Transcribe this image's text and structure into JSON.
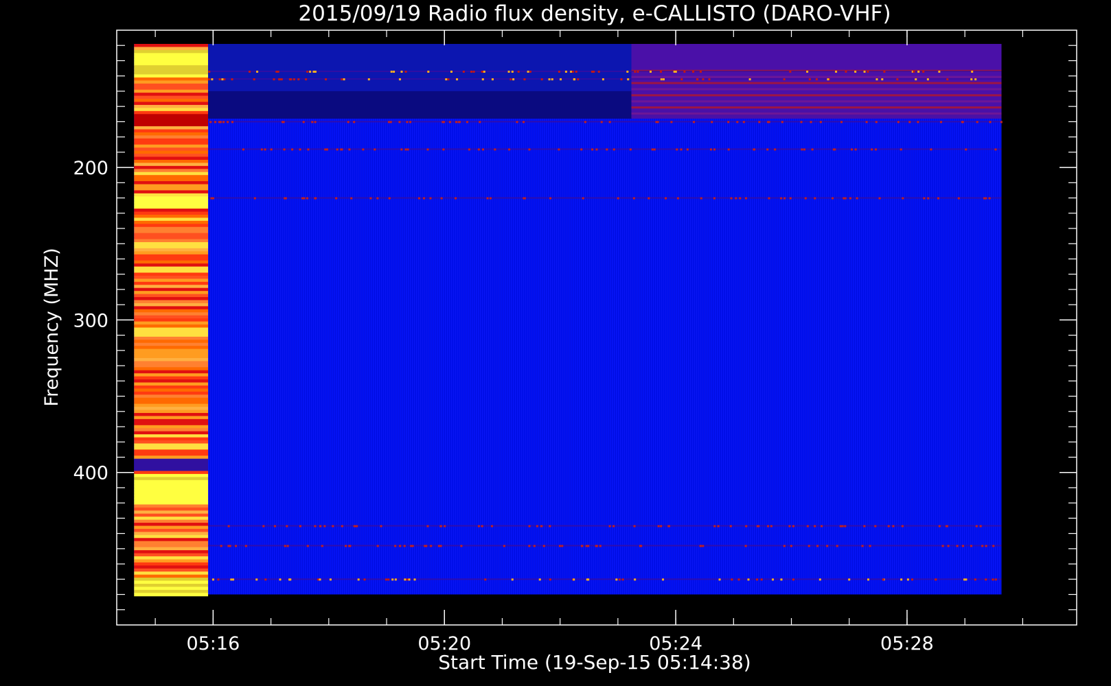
{
  "chart_data": {
    "type": "heatmap",
    "title": "2015/09/19  Radio flux density, e-CALLISTO (DARO-VHF)",
    "xlabel": "Start Time (19-Sep-15 05:14:38)",
    "ylabel": "Frequency (MHZ)",
    "x_units": "minutes after 05:14:38",
    "xlim": [
      -0.3,
      16.3
    ],
    "ylim_top_to_bottom": [
      110,
      500
    ],
    "x_ticks": [
      {
        "label": "05:16",
        "minutes": 1.3667
      },
      {
        "label": "05:20",
        "minutes": 5.3667
      },
      {
        "label": "05:24",
        "minutes": 9.3667
      },
      {
        "label": "05:28",
        "minutes": 13.3667
      }
    ],
    "y_ticks": [
      {
        "label": "200",
        "mhz": 200
      },
      {
        "label": "300",
        "mhz": 300
      },
      {
        "label": "400",
        "mhz": 400
      }
    ],
    "data_extent": {
      "t_start_min": 0,
      "t_end_min": 15.0,
      "f_top_mhz": 119,
      "f_bottom_mhz": 480
    },
    "regions": [
      {
        "name": "calibration",
        "t_start_min": 0,
        "t_end_min": 1.28,
        "level": "high"
      },
      {
        "name": "background",
        "t_start_min": 1.28,
        "t_end_min": 15.0,
        "level": "low"
      },
      {
        "name": "upper-band-dark",
        "t_start_min": 1.28,
        "t_end_min": 8.6,
        "f_start_mhz": 119,
        "f_end_mhz": 168,
        "level": "very-low"
      },
      {
        "name": "upper-band-rfi",
        "t_start_min": 8.6,
        "t_end_min": 15.0,
        "f_start_mhz": 119,
        "f_end_mhz": 168,
        "level": "medium"
      }
    ],
    "rfi_lines_mhz": [
      137,
      142,
      170,
      188,
      220,
      435,
      448,
      470
    ],
    "colors": {
      "background": "#0010f0",
      "low": "#0a0a80",
      "medium": "#c01818",
      "high": "#ff6a00",
      "max": "#ffff40"
    }
  }
}
